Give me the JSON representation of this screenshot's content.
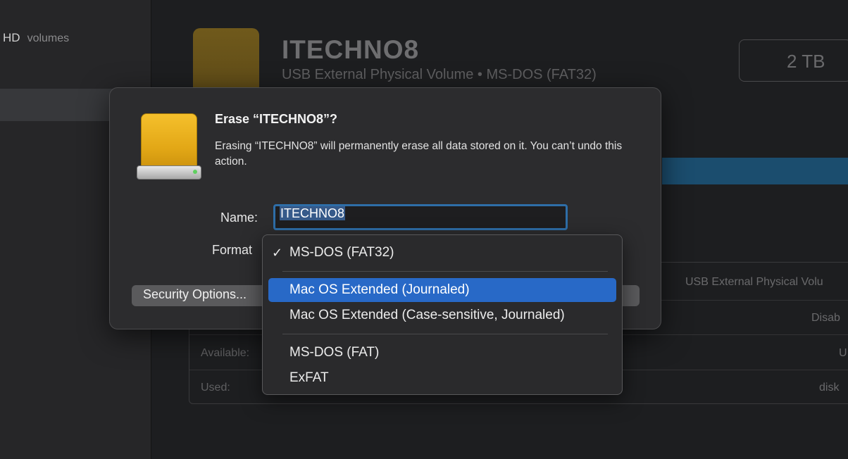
{
  "sidebar": {
    "header": "HD",
    "header_sub": "volumes"
  },
  "background": {
    "volume_title": "ITECHNO8",
    "volume_subtitle": "USB External Physical Volume • MS-DOS (FAT32)",
    "capacity": "2 TB",
    "info_rows": [
      {
        "label": "",
        "value": "USB External Physical Volu"
      },
      {
        "label": "",
        "value": "Disab"
      },
      {
        "label": "Available:",
        "value": "U"
      },
      {
        "label": "Used:",
        "value": "disk"
      }
    ],
    "colors": {
      "usage_bar": "#1b4d6e"
    }
  },
  "dialog": {
    "title": "Erase “ITECHNO8”?",
    "message": "Erasing “ITECHNO8” will permanently erase all data stored on it. You can’t undo this action.",
    "name_label": "Name:",
    "name_value": "ITECHNO8",
    "format_label": "Format",
    "security_button": "Security Options...",
    "icon": "external-drive-icon"
  },
  "format_menu": {
    "checkmark": "✓",
    "selected_index": 0,
    "highlighted_index": 1,
    "items": [
      {
        "label": "MS-DOS (FAT32)"
      },
      {
        "label": "Mac OS Extended (Journaled)"
      },
      {
        "label": "Mac OS Extended (Case-sensitive, Journaled)"
      },
      {
        "label": "MS-DOS (FAT)"
      },
      {
        "label": "ExFAT"
      }
    ],
    "colors": {
      "highlight": "#2869c7"
    }
  }
}
